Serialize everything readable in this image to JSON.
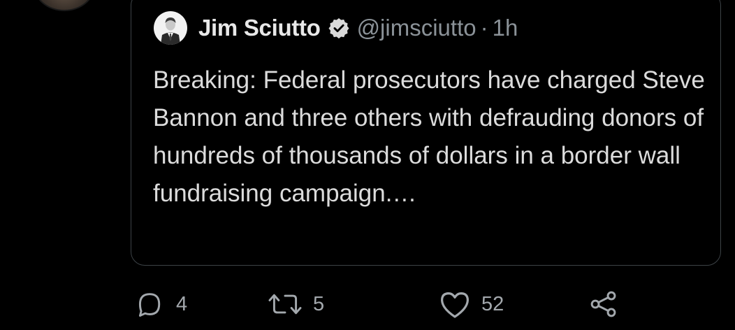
{
  "quoted_tweet": {
    "author_name": "Jim Sciutto",
    "handle": "@jimsciutto",
    "separator": "·",
    "time": "1h",
    "text": "Breaking: Federal prosecutors have charged Steve Bannon and three others with defrauding donors of hundreds of thousands of dollars in a border wall fundraising campaign.…",
    "verified_icon": "verified-badge-icon",
    "verified_color": "#d9d9d9"
  },
  "actions": {
    "reply": {
      "icon": "reply-icon",
      "count": "4"
    },
    "retweet": {
      "icon": "retweet-icon",
      "count": "5"
    },
    "like": {
      "icon": "heart-icon",
      "count": "52"
    },
    "share": {
      "icon": "share-icon"
    }
  },
  "colors": {
    "background": "#000000",
    "card_border": "#3d4347",
    "secondary_text": "#8b9298",
    "icon": "#a3a8ad"
  }
}
